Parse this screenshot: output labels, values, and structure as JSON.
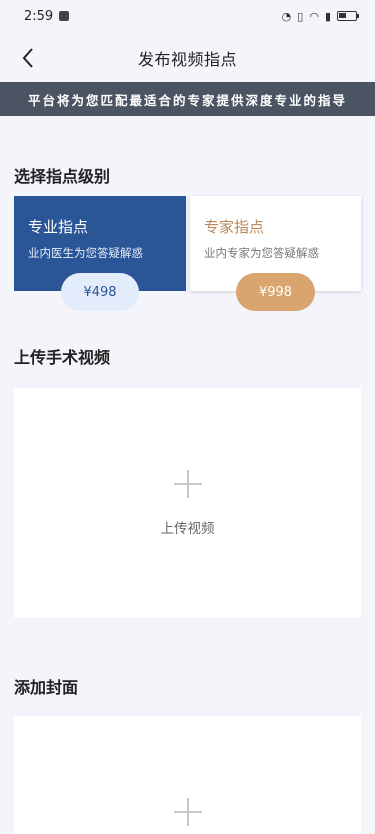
{
  "status_bar": {
    "time": "2:59",
    "right_icons": [
      "speed-icon",
      "vibrate-icon",
      "wifi-icon",
      "alert-icon",
      "battery-icon"
    ]
  },
  "nav": {
    "title": "发布视频指点",
    "back_icon": "chevron-left-icon"
  },
  "banner": {
    "text": "平台将为您匹配最适合的专家提供深度专业的指导"
  },
  "level_section": {
    "title": "选择指点级别",
    "plans": [
      {
        "name": "专业指点",
        "desc": "业内医生为您答疑解惑",
        "price": "¥498",
        "selected": true
      },
      {
        "name": "专家指点",
        "desc": "业内专家为您答疑解惑",
        "price": "¥998",
        "selected": false
      }
    ],
    "colors": {
      "selected_bg": "#2a5597",
      "expert_accent": "#b9895a",
      "expert_pill": "#d9a46d"
    }
  },
  "video_section": {
    "title": "上传手术视频",
    "upload_label": "上传视频"
  },
  "cover_section": {
    "title": "添加封面"
  }
}
